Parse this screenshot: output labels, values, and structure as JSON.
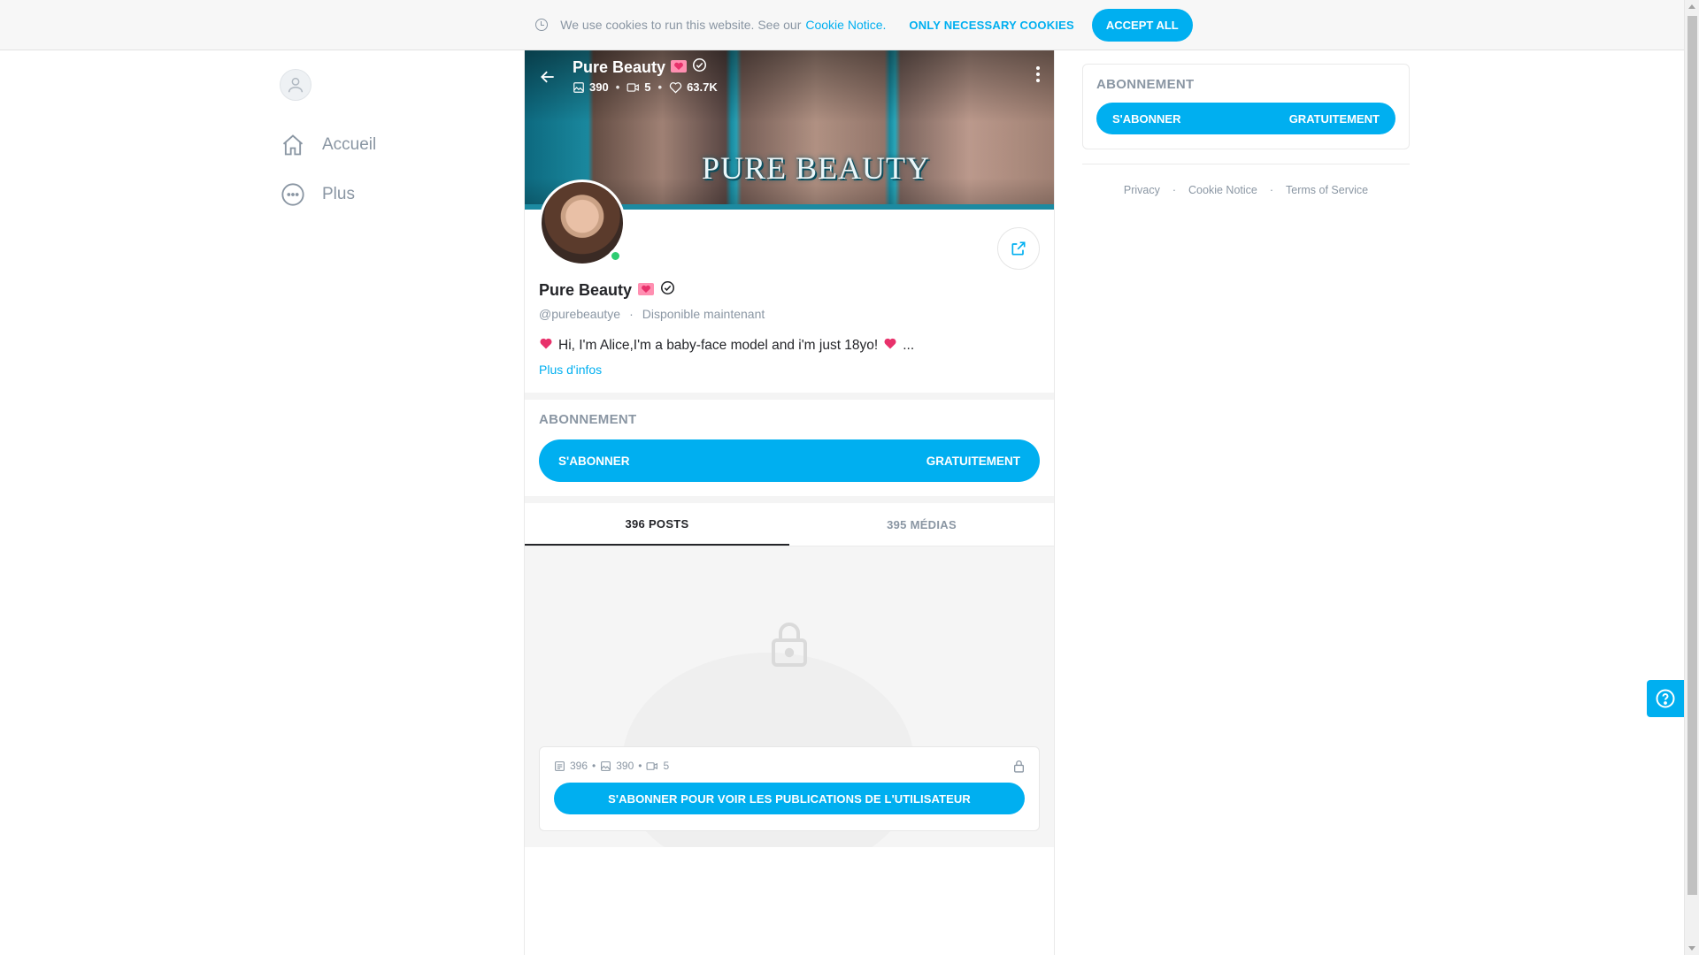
{
  "cookie_bar": {
    "message": "We use cookies to run this website. See our",
    "link": "Cookie Notice.",
    "necessary_label": "ONLY NECESSARY COOKIES",
    "accept_label": "ACCEPT ALL"
  },
  "nav": {
    "items": [
      {
        "label": "Accueil",
        "icon": "home-icon"
      },
      {
        "label": "Plus",
        "icon": "more-circle-icon"
      }
    ]
  },
  "cover": {
    "title": "Pure Beauty",
    "banner_text": "PURE BEAUTY",
    "stats": {
      "photos": "390",
      "videos": "5",
      "likes": "63.7K"
    }
  },
  "profile": {
    "name": "Pure Beauty",
    "handle": "@purebeautye",
    "status": "Disponible maintenant",
    "bio": "Hi, I'm Alice,I'm a baby-face model and i'm just 18yo!",
    "bio_suffix": "...",
    "more_info": "Plus d'infos"
  },
  "subscription": {
    "title": "ABONNEMENT",
    "button_left": "S'ABONNER",
    "button_right": "GRATUITEMENT"
  },
  "tabs": [
    {
      "label": "396 POSTS",
      "active": true
    },
    {
      "label": "395 MÉDIAS",
      "active": false
    }
  ],
  "locked": {
    "posts": "396",
    "photos": "390",
    "videos": "5",
    "button": "S'ABONNER POUR VOIR LES PUBLICATIONS DE L'UTILISATEUR"
  },
  "sidebar": {
    "title": "ABONNEMENT",
    "button_left": "S'ABONNER",
    "button_right": "GRATUITEMENT",
    "footer": [
      "Privacy",
      "Cookie Notice",
      "Terms of Service"
    ]
  },
  "colors": {
    "accent": "#00aff0",
    "muted": "#8a96a3",
    "online": "#2ecc71",
    "heart": "#e8316b"
  }
}
